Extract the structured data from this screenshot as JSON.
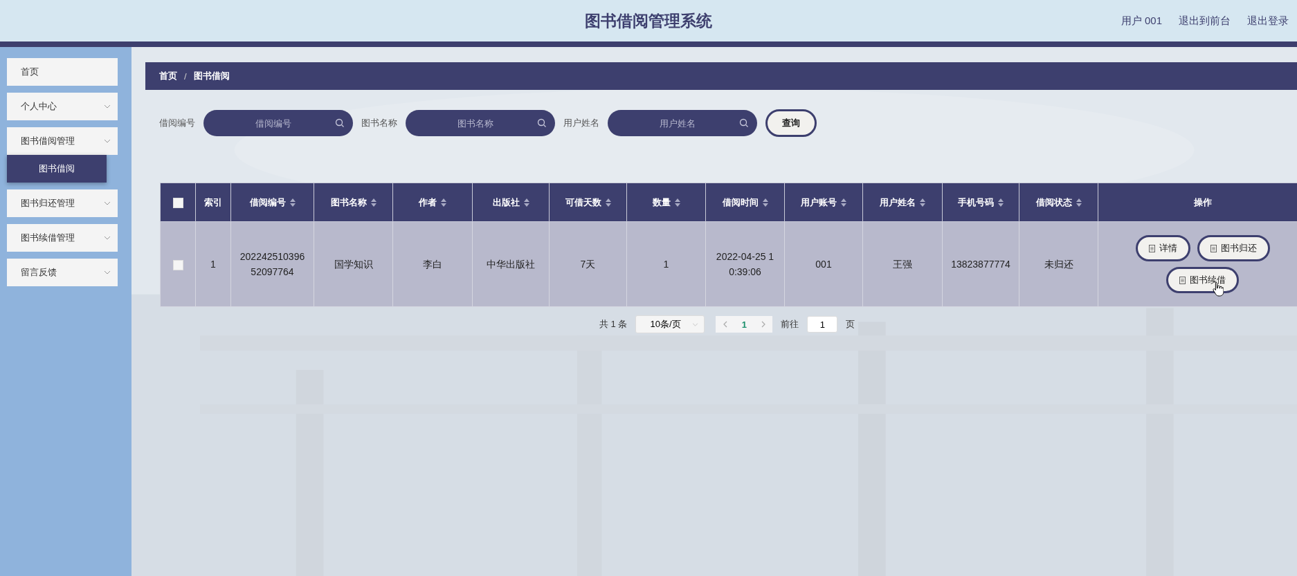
{
  "header": {
    "title": "图书借阅管理系统",
    "links": [
      "用户 001",
      "退出到前台",
      "退出登录"
    ]
  },
  "sidebar": {
    "items": [
      {
        "label": "首页",
        "expandable": false
      },
      {
        "label": "个人中心",
        "expandable": true
      },
      {
        "label": "图书借阅管理",
        "expandable": true,
        "children": [
          {
            "label": "图书借阅",
            "selected": true
          }
        ]
      },
      {
        "label": "图书归还管理",
        "expandable": true
      },
      {
        "label": "图书续借管理",
        "expandable": true
      },
      {
        "label": "留言反馈",
        "expandable": true
      }
    ]
  },
  "breadcrumb": {
    "items": [
      "首页",
      "图书借阅"
    ],
    "separator": "/"
  },
  "search": {
    "fields": [
      {
        "label": "借阅编号",
        "placeholder": "借阅编号"
      },
      {
        "label": "图书名称",
        "placeholder": "图书名称"
      },
      {
        "label": "用户姓名",
        "placeholder": "用户姓名"
      }
    ],
    "button": "查询"
  },
  "table": {
    "select_all_checked": false,
    "columns": [
      {
        "label": "索引",
        "sortable": false
      },
      {
        "label": "借阅编号",
        "sortable": true
      },
      {
        "label": "图书名称",
        "sortable": true
      },
      {
        "label": "作者",
        "sortable": true
      },
      {
        "label": "出版社",
        "sortable": true
      },
      {
        "label": "可借天数",
        "sortable": true
      },
      {
        "label": "数量",
        "sortable": true
      },
      {
        "label": "借阅时间",
        "sortable": true
      },
      {
        "label": "用户账号",
        "sortable": true
      },
      {
        "label": "用户姓名",
        "sortable": true
      },
      {
        "label": "手机号码",
        "sortable": true
      },
      {
        "label": "借阅状态",
        "sortable": true
      },
      {
        "label": "操作",
        "sortable": false
      }
    ],
    "rows": [
      {
        "checked": false,
        "cells": [
          "1",
          "20224251039652097764",
          "国学知识",
          "李白",
          "中华出版社",
          "7天",
          "1",
          "2022-04-25 10:39:06",
          "001",
          "王强",
          "13823877774",
          "未归还"
        ],
        "actions": [
          "详情",
          "图书归还",
          "图书续借"
        ]
      }
    ]
  },
  "pagination": {
    "total": "共 1 条",
    "page_size": "10条/页",
    "current": "1",
    "jump_label": "前往",
    "jump_value": "1",
    "jump_suffix": "页"
  }
}
